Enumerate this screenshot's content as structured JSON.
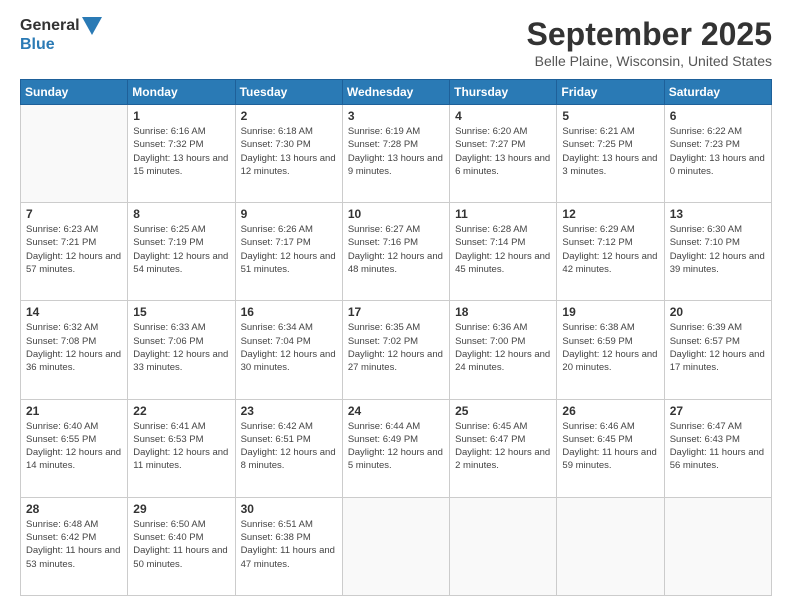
{
  "logo": {
    "line1": "General",
    "line2": "Blue"
  },
  "header": {
    "month": "September 2025",
    "location": "Belle Plaine, Wisconsin, United States"
  },
  "weekdays": [
    "Sunday",
    "Monday",
    "Tuesday",
    "Wednesday",
    "Thursday",
    "Friday",
    "Saturday"
  ],
  "weeks": [
    [
      {
        "day": "",
        "sunrise": "",
        "sunset": "",
        "daylight": ""
      },
      {
        "day": "1",
        "sunrise": "Sunrise: 6:16 AM",
        "sunset": "Sunset: 7:32 PM",
        "daylight": "Daylight: 13 hours and 15 minutes."
      },
      {
        "day": "2",
        "sunrise": "Sunrise: 6:18 AM",
        "sunset": "Sunset: 7:30 PM",
        "daylight": "Daylight: 13 hours and 12 minutes."
      },
      {
        "day": "3",
        "sunrise": "Sunrise: 6:19 AM",
        "sunset": "Sunset: 7:28 PM",
        "daylight": "Daylight: 13 hours and 9 minutes."
      },
      {
        "day": "4",
        "sunrise": "Sunrise: 6:20 AM",
        "sunset": "Sunset: 7:27 PM",
        "daylight": "Daylight: 13 hours and 6 minutes."
      },
      {
        "day": "5",
        "sunrise": "Sunrise: 6:21 AM",
        "sunset": "Sunset: 7:25 PM",
        "daylight": "Daylight: 13 hours and 3 minutes."
      },
      {
        "day": "6",
        "sunrise": "Sunrise: 6:22 AM",
        "sunset": "Sunset: 7:23 PM",
        "daylight": "Daylight: 13 hours and 0 minutes."
      }
    ],
    [
      {
        "day": "7",
        "sunrise": "Sunrise: 6:23 AM",
        "sunset": "Sunset: 7:21 PM",
        "daylight": "Daylight: 12 hours and 57 minutes."
      },
      {
        "day": "8",
        "sunrise": "Sunrise: 6:25 AM",
        "sunset": "Sunset: 7:19 PM",
        "daylight": "Daylight: 12 hours and 54 minutes."
      },
      {
        "day": "9",
        "sunrise": "Sunrise: 6:26 AM",
        "sunset": "Sunset: 7:17 PM",
        "daylight": "Daylight: 12 hours and 51 minutes."
      },
      {
        "day": "10",
        "sunrise": "Sunrise: 6:27 AM",
        "sunset": "Sunset: 7:16 PM",
        "daylight": "Daylight: 12 hours and 48 minutes."
      },
      {
        "day": "11",
        "sunrise": "Sunrise: 6:28 AM",
        "sunset": "Sunset: 7:14 PM",
        "daylight": "Daylight: 12 hours and 45 minutes."
      },
      {
        "day": "12",
        "sunrise": "Sunrise: 6:29 AM",
        "sunset": "Sunset: 7:12 PM",
        "daylight": "Daylight: 12 hours and 42 minutes."
      },
      {
        "day": "13",
        "sunrise": "Sunrise: 6:30 AM",
        "sunset": "Sunset: 7:10 PM",
        "daylight": "Daylight: 12 hours and 39 minutes."
      }
    ],
    [
      {
        "day": "14",
        "sunrise": "Sunrise: 6:32 AM",
        "sunset": "Sunset: 7:08 PM",
        "daylight": "Daylight: 12 hours and 36 minutes."
      },
      {
        "day": "15",
        "sunrise": "Sunrise: 6:33 AM",
        "sunset": "Sunset: 7:06 PM",
        "daylight": "Daylight: 12 hours and 33 minutes."
      },
      {
        "day": "16",
        "sunrise": "Sunrise: 6:34 AM",
        "sunset": "Sunset: 7:04 PM",
        "daylight": "Daylight: 12 hours and 30 minutes."
      },
      {
        "day": "17",
        "sunrise": "Sunrise: 6:35 AM",
        "sunset": "Sunset: 7:02 PM",
        "daylight": "Daylight: 12 hours and 27 minutes."
      },
      {
        "day": "18",
        "sunrise": "Sunrise: 6:36 AM",
        "sunset": "Sunset: 7:00 PM",
        "daylight": "Daylight: 12 hours and 24 minutes."
      },
      {
        "day": "19",
        "sunrise": "Sunrise: 6:38 AM",
        "sunset": "Sunset: 6:59 PM",
        "daylight": "Daylight: 12 hours and 20 minutes."
      },
      {
        "day": "20",
        "sunrise": "Sunrise: 6:39 AM",
        "sunset": "Sunset: 6:57 PM",
        "daylight": "Daylight: 12 hours and 17 minutes."
      }
    ],
    [
      {
        "day": "21",
        "sunrise": "Sunrise: 6:40 AM",
        "sunset": "Sunset: 6:55 PM",
        "daylight": "Daylight: 12 hours and 14 minutes."
      },
      {
        "day": "22",
        "sunrise": "Sunrise: 6:41 AM",
        "sunset": "Sunset: 6:53 PM",
        "daylight": "Daylight: 12 hours and 11 minutes."
      },
      {
        "day": "23",
        "sunrise": "Sunrise: 6:42 AM",
        "sunset": "Sunset: 6:51 PM",
        "daylight": "Daylight: 12 hours and 8 minutes."
      },
      {
        "day": "24",
        "sunrise": "Sunrise: 6:44 AM",
        "sunset": "Sunset: 6:49 PM",
        "daylight": "Daylight: 12 hours and 5 minutes."
      },
      {
        "day": "25",
        "sunrise": "Sunrise: 6:45 AM",
        "sunset": "Sunset: 6:47 PM",
        "daylight": "Daylight: 12 hours and 2 minutes."
      },
      {
        "day": "26",
        "sunrise": "Sunrise: 6:46 AM",
        "sunset": "Sunset: 6:45 PM",
        "daylight": "Daylight: 11 hours and 59 minutes."
      },
      {
        "day": "27",
        "sunrise": "Sunrise: 6:47 AM",
        "sunset": "Sunset: 6:43 PM",
        "daylight": "Daylight: 11 hours and 56 minutes."
      }
    ],
    [
      {
        "day": "28",
        "sunrise": "Sunrise: 6:48 AM",
        "sunset": "Sunset: 6:42 PM",
        "daylight": "Daylight: 11 hours and 53 minutes."
      },
      {
        "day": "29",
        "sunrise": "Sunrise: 6:50 AM",
        "sunset": "Sunset: 6:40 PM",
        "daylight": "Daylight: 11 hours and 50 minutes."
      },
      {
        "day": "30",
        "sunrise": "Sunrise: 6:51 AM",
        "sunset": "Sunset: 6:38 PM",
        "daylight": "Daylight: 11 hours and 47 minutes."
      },
      {
        "day": "",
        "sunrise": "",
        "sunset": "",
        "daylight": ""
      },
      {
        "day": "",
        "sunrise": "",
        "sunset": "",
        "daylight": ""
      },
      {
        "day": "",
        "sunrise": "",
        "sunset": "",
        "daylight": ""
      },
      {
        "day": "",
        "sunrise": "",
        "sunset": "",
        "daylight": ""
      }
    ]
  ]
}
